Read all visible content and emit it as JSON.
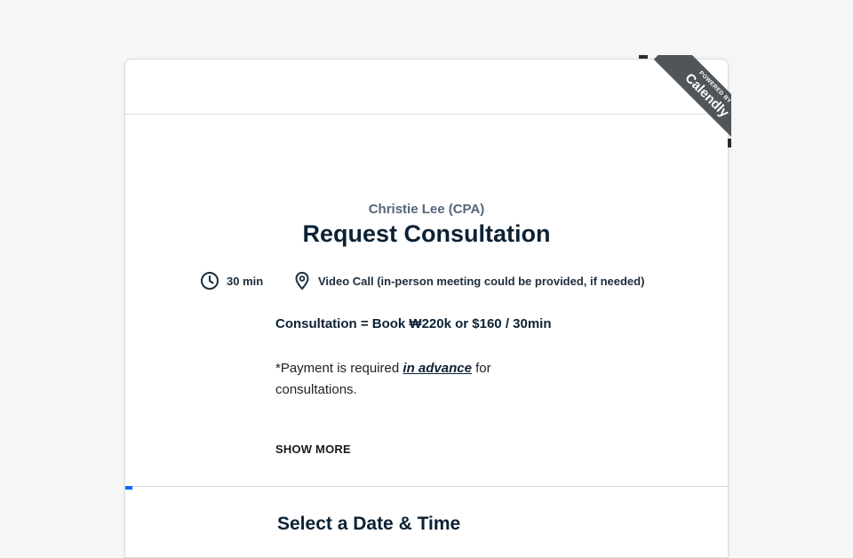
{
  "ribbon": {
    "powered_by": "POWERED BY",
    "brand": "Calendly"
  },
  "event": {
    "host": "Christie Lee (CPA)",
    "title": "Request Consultation",
    "duration": "30 min",
    "location": "Video Call (in-person meeting could be provided, if needed)"
  },
  "description": {
    "pricing": "Consultation = Book ₩220k or $160 / 30min",
    "payment_prefix": "*Payment is required ",
    "payment_emphasis": "in advance",
    "payment_suffix": " for consultations.",
    "show_more": "SHOW MORE"
  },
  "scheduler": {
    "title": "Select a Date & Time"
  },
  "icons": {
    "duration": "clock-icon",
    "location": "location-pin-icon"
  },
  "colors": {
    "accent": "#0069ff",
    "heading": "#0c2134",
    "host": "#54657a",
    "ribbon": "#505559"
  }
}
